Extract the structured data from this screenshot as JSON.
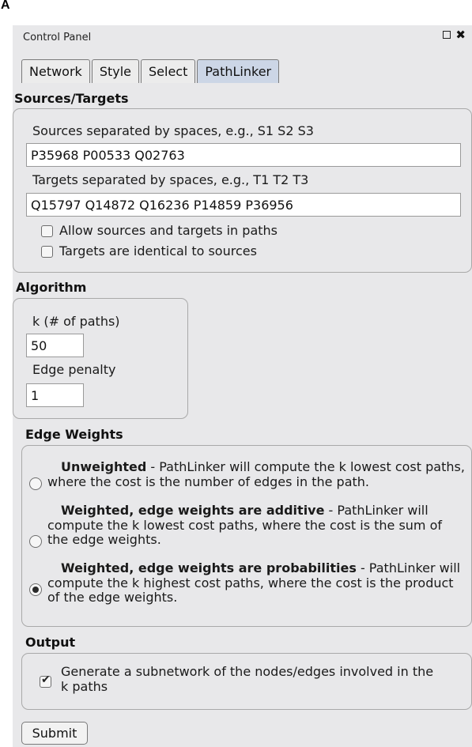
{
  "figure_label": "A",
  "window": {
    "title": "Control Panel",
    "icons": [
      "maximize-icon",
      "close-icon"
    ]
  },
  "tabs": [
    {
      "label": "Network",
      "active": false
    },
    {
      "label": "Style",
      "active": false
    },
    {
      "label": "Select",
      "active": false
    },
    {
      "label": "PathLinker",
      "active": true
    }
  ],
  "sources_targets": {
    "title": "Sources/Targets",
    "sources_label": "Sources separated by spaces, e.g., S1 S2 S3",
    "sources_value": "P35968 P00533 Q02763",
    "targets_label": "Targets separated by spaces, e.g., T1 T2 T3",
    "targets_value": "Q15797 Q14872 Q16236 P14859 P36956",
    "allow_in_paths": {
      "label": "Allow sources and targets in paths",
      "checked": false
    },
    "identical": {
      "label": "Targets are identical to sources",
      "checked": false
    }
  },
  "algorithm": {
    "title": "Algorithm",
    "k_label": "k (# of paths)",
    "k_value": "50",
    "penalty_label": "Edge penalty",
    "penalty_value": "1"
  },
  "edge_weights": {
    "title": "Edge Weights",
    "options": [
      {
        "name": "Unweighted",
        "desc": " - PathLinker will compute the k lowest cost paths, where the cost is the number of edges in the path.",
        "checked": false
      },
      {
        "name": "Weighted, edge weights are additive",
        "desc": " - PathLinker will compute the k lowest cost paths, where the cost is the sum of the edge weights.",
        "checked": false
      },
      {
        "name": "Weighted, edge weights are probabilities",
        "desc": " - PathLinker will compute the k highest cost paths, where the cost is the product of the edge weights.",
        "checked": true
      }
    ]
  },
  "output": {
    "title": "Output",
    "subnetwork": {
      "label": "Generate a subnetwork of the nodes/edges involved in the k paths",
      "checked": true
    }
  },
  "submit_label": "Submit"
}
